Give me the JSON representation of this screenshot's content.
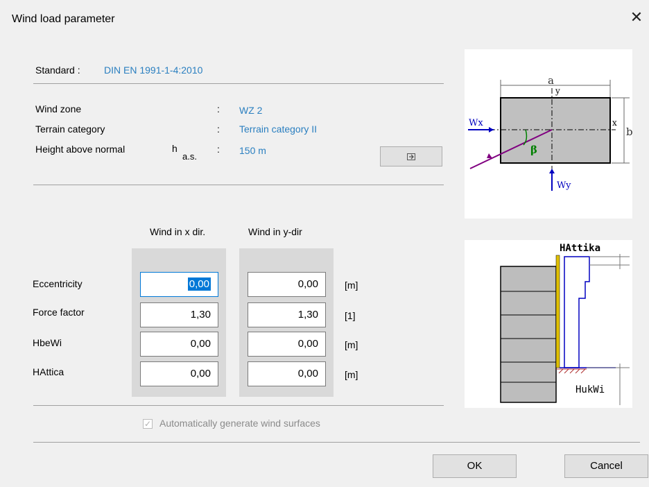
{
  "window": {
    "title": "Wind load parameter"
  },
  "header": {
    "standard_label": "Standard :",
    "standard_value": "DIN EN 1991-1-4:2010"
  },
  "params": {
    "wind_zone_label": "Wind zone",
    "wind_zone_value": "WZ  2",
    "terrain_label": "Terrain category",
    "terrain_value": "Terrain category II",
    "height_label": "Height above normal",
    "height_symbol": "h",
    "height_subscript": "a.s.",
    "height_value": "150 m",
    "colon": ":"
  },
  "columns": {
    "x_header": "Wind in x dir.",
    "y_header": "Wind in y-dir"
  },
  "rows": [
    {
      "label": "Eccentricity",
      "x": "0,00",
      "y": "0,00",
      "unit": "[m]"
    },
    {
      "label": "Force factor",
      "x": "1,30",
      "y": "1,30",
      "unit": "[1]"
    },
    {
      "label": "HbeWi",
      "x": "0,00",
      "y": "0,00",
      "unit": "[m]"
    },
    {
      "label": "HAttica",
      "x": "0,00",
      "y": "0,00",
      "unit": "[m]"
    }
  ],
  "checkbox": {
    "label": "Automatically generate wind surfaces",
    "checked": true,
    "enabled": false
  },
  "buttons": {
    "ok": "OK",
    "cancel": "Cancel"
  },
  "diagram_top": {
    "a": "a",
    "y": "y",
    "x": "x",
    "b": "b",
    "wx": "Wx",
    "wy": "Wy",
    "beta": "β"
  },
  "diagram_bottom": {
    "hattika": "HAttika",
    "hukwi": "HukWi"
  },
  "colors": {
    "accent": "#2a7fc0",
    "focus": "#0078d7"
  }
}
